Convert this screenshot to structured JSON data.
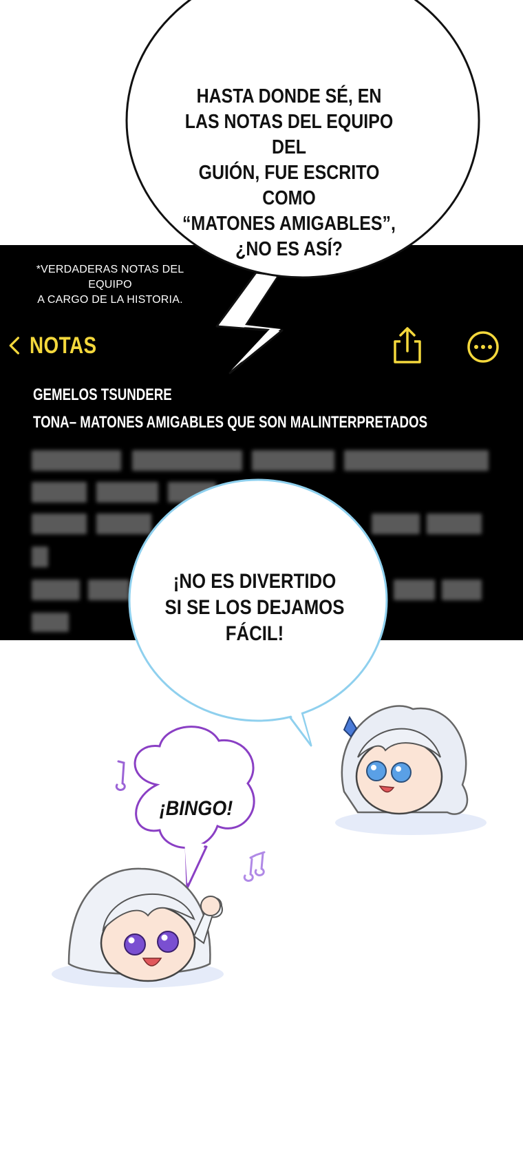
{
  "speech_bubbles": {
    "top": [
      "HASTA DONDE SÉ, EN",
      "LAS NOTAS DEL EQUIPO DEL",
      "GUIÓN, FUE ESCRITO COMO",
      "“MATONES AMIGABLES”,",
      "¿NO ES ASÍ?"
    ],
    "middle": [
      "¡NO ES DIVERTIDO",
      "SI SE LOS DEJAMOS",
      "FÁCIL!"
    ],
    "small": "¡BINGO!"
  },
  "caption": [
    "*VERDADERAS NOTAS DEL EQUIPO",
    "A CARGO DE LA HISTORIA."
  ],
  "notes_app": {
    "back_label": "NOTAS",
    "accent_color": "#f4d83c",
    "icons": [
      "chevron-left-icon",
      "share-icon",
      "more-icon"
    ],
    "lines": [
      "GEMELOS TSUNDERE",
      "TONA– MATONES AMIGABLES QUE SON MALINTERPRETADOS"
    ]
  },
  "colors": {
    "panel": "#000000",
    "bubble_blue_outline": "#8fd0ee",
    "bubble_purple_outline": "#8a3fc4"
  }
}
